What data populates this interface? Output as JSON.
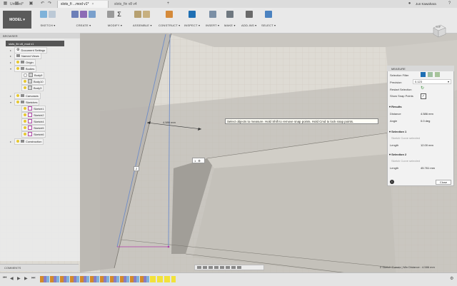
{
  "colors": {
    "accent": "#0a6ebd",
    "model_bg": "#5a5a5a",
    "tooltip_bg": "#fffef6",
    "sketch_line": "#6e8cc8",
    "sketch_point": "#b03ca8"
  },
  "tabs": [
    {
      "label": "Untitled*",
      "active": false
    },
    {
      "label": "slots_fi ...mod v1*",
      "active": true
    },
    {
      "label": "slots_fin v8 v4",
      "active": false
    }
  ],
  "user_name": "Jun Kawahara",
  "toolbar": {
    "model_label": "MODEL ▾",
    "groups": [
      {
        "label": "SKETCH ▾",
        "icons": 2
      },
      {
        "label": "CREATE ▾",
        "icons": 3
      },
      {
        "label": "MODIFY ▾",
        "icons": 2
      },
      {
        "label": "ASSEMBLE ▾",
        "icons": 2
      },
      {
        "label": "CONSTRUCT ▾",
        "icons": 1
      },
      {
        "label": "INSPECT ▾",
        "icons": 1
      },
      {
        "label": "INSERT ▾",
        "icons": 1
      },
      {
        "label": "MAKE ▾",
        "icons": 1
      },
      {
        "label": "ADD-INS ▾",
        "icons": 1
      },
      {
        "label": "SELECT ▾",
        "icons": 1
      }
    ]
  },
  "browser": {
    "title": "BROWSER",
    "root": "slots_fin v8_mod v1",
    "items": [
      {
        "label": "Document Settings",
        "kind": "gear",
        "level": 1
      },
      {
        "label": "Named Views",
        "kind": "folder",
        "level": 1
      },
      {
        "label": "Origin",
        "kind": "folder",
        "level": 1
      },
      {
        "label": "Bodies",
        "kind": "folder",
        "level": 1
      },
      {
        "label": "Body9",
        "kind": "body",
        "level": 2
      },
      {
        "label": "Body10",
        "kind": "body",
        "level": 2
      },
      {
        "label": "Body3",
        "kind": "body",
        "level": 2
      },
      {
        "label": "Canvases",
        "kind": "folder",
        "level": 1
      },
      {
        "label": "Sketches",
        "kind": "folder",
        "level": 1
      },
      {
        "label": "Sketch1",
        "kind": "sketch",
        "level": 2
      },
      {
        "label": "Sketch2",
        "kind": "sketch",
        "level": 2
      },
      {
        "label": "Sketch4",
        "kind": "sketch",
        "level": 2
      },
      {
        "label": "Sketch5",
        "kind": "sketch",
        "level": 2
      },
      {
        "label": "Sketch6",
        "kind": "sketch",
        "level": 2
      },
      {
        "label": "Construction",
        "kind": "folder",
        "level": 1
      }
    ]
  },
  "comments_label": "COMMENTS",
  "measure": {
    "title": "MEASURE",
    "selection_filter_label": "Selection Filter",
    "precision_label": "Precision",
    "precision_value": "0.123",
    "restart_label": "Restart Selection",
    "snap_label": "Show Snap Points",
    "results_label": "Results",
    "distance_label": "Distance",
    "distance_value": "4.586 mm",
    "angle_label": "Angle",
    "angle_value": "0.0 deg",
    "sel1_label": "Selection 1",
    "sel1_hint": "Sketch Curve selected",
    "sel1_len_label": "Length",
    "sel1_len_value": "12.00 mm",
    "sel2_label": "Selection 2",
    "sel2_hint": "Sketch Curve selected",
    "sel2_len_label": "Length",
    "sel2_len_value": "45.761 mm",
    "close_label": "Close"
  },
  "tooltip": "Select objects to measure. Hold Shift to remove snap points. Hold Cmd to lock snap points.",
  "dimension_label": "4.586 mm",
  "point_labels": [
    "1",
    "2"
  ],
  "viewcube_label": "TOP",
  "status_text": "2 Sketch Curves | Min Distance : 4.586 mm"
}
